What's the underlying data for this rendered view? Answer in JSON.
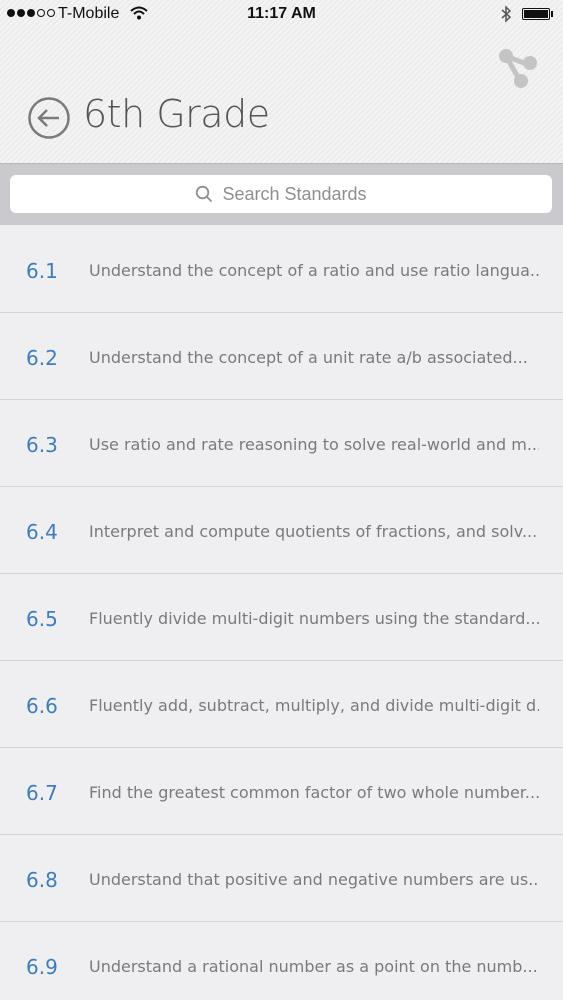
{
  "status_bar": {
    "signal_dots_filled": 3,
    "signal_dots_total": 5,
    "carrier": "T-Mobile",
    "time": "11:17 AM",
    "wifi_icon": "wifi-icon",
    "bluetooth_icon": "bluetooth-icon",
    "battery_level": 1.0
  },
  "header": {
    "back_icon": "back-arrow-icon",
    "title": "6th Grade",
    "share_icon": "share-icon"
  },
  "search": {
    "placeholder": "Search Standards",
    "icon": "search-icon"
  },
  "colors": {
    "accent": "#3d7dbd",
    "text_muted": "#7a7a7a",
    "background": "#efeff1"
  },
  "standards": [
    {
      "code": "6.1",
      "text": "Understand the concept of a ratio and use ratio langua..."
    },
    {
      "code": "6.2",
      "text": "Understand the concept of a unit rate a/b associated..."
    },
    {
      "code": "6.3",
      "text": "Use ratio and rate reasoning to solve real-world and m..."
    },
    {
      "code": "6.4",
      "text": "Interpret and compute quotients of fractions, and solv..."
    },
    {
      "code": "6.5",
      "text": "Fluently divide multi-digit numbers using the standard..."
    },
    {
      "code": "6.6",
      "text": "Fluently add, subtract, multiply, and divide multi-digit d..."
    },
    {
      "code": "6.7",
      "text": "Find the greatest common factor of two whole number..."
    },
    {
      "code": "6.8",
      "text": "Understand that positive and negative numbers are us..."
    },
    {
      "code": "6.9",
      "text": "Understand a rational number as a point on the numb..."
    }
  ]
}
